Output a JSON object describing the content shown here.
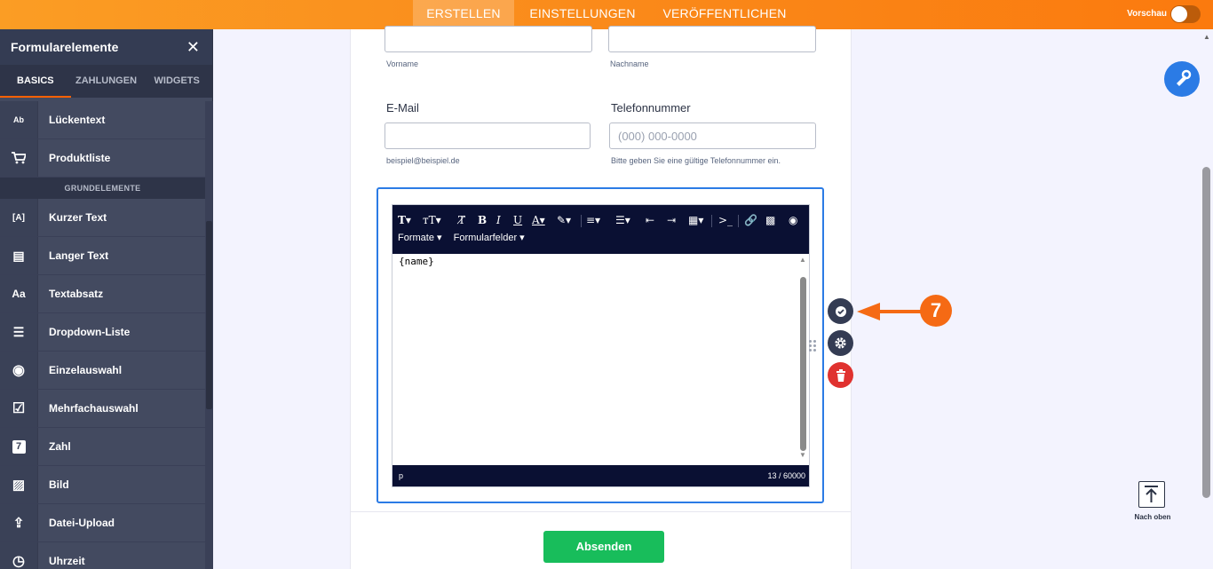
{
  "topbar": {
    "tabs": [
      "ERSTELLEN",
      "EINSTELLUNGEN",
      "VERÖFFENTLICHEN"
    ],
    "preview_label": "Vorschau"
  },
  "sidebar": {
    "title": "Formularelemente",
    "close_glyph": "✕",
    "tabs": [
      "BASICS",
      "ZAHLUNGEN",
      "WIDGETS"
    ],
    "items_top": [
      {
        "icon": "fill-in-blank-icon",
        "glyph": "Ab",
        "label": "Lückentext"
      },
      {
        "icon": "cart-icon",
        "glyph": "🛒",
        "label": "Produktliste"
      }
    ],
    "section": "GRUNDELEMENTE",
    "items": [
      {
        "icon": "short-text-icon",
        "glyph": "[A]",
        "label": "Kurzer Text"
      },
      {
        "icon": "long-text-icon",
        "glyph": "▤",
        "label": "Langer Text"
      },
      {
        "icon": "paragraph-icon",
        "glyph": "Aa",
        "label": "Textabsatz"
      },
      {
        "icon": "dropdown-icon",
        "glyph": "☰",
        "label": "Dropdown-Liste"
      },
      {
        "icon": "radio-icon",
        "glyph": "◉",
        "label": "Einzelauswahl"
      },
      {
        "icon": "checkbox-icon",
        "glyph": "☑",
        "label": "Mehrfachauswahl"
      },
      {
        "icon": "number-icon",
        "glyph": "7",
        "label": "Zahl"
      },
      {
        "icon": "image-icon",
        "glyph": "▨",
        "label": "Bild"
      },
      {
        "icon": "upload-icon",
        "glyph": "⇪",
        "label": "Datei-Upload"
      },
      {
        "icon": "clock-icon",
        "glyph": "◷",
        "label": "Uhrzeit"
      }
    ]
  },
  "form": {
    "first_name_sub": "Vorname",
    "last_name_sub": "Nachname",
    "email_label": "E-Mail",
    "email_sub": "beispiel@beispiel.de",
    "phone_label": "Telefonnummer",
    "phone_placeholder": "(000) 000-0000",
    "phone_sub": "Bitte geben Sie eine gültige Telefonnummer ein.",
    "editor": {
      "menu_formats": "Formate ▾",
      "menu_fields": "Formularfelder ▾",
      "content": "{name}",
      "status_tag": "p",
      "char_count": "13 / 60000"
    },
    "submit_label": "Absenden"
  },
  "annotation": {
    "step_number": "7",
    "color": "#f56a14"
  },
  "to_top_label": "Nach oben",
  "colors": {
    "accent": "#fa8a1a",
    "primary": "#2b7be5",
    "submit": "#18bd5b",
    "delete": "#e0322f"
  }
}
